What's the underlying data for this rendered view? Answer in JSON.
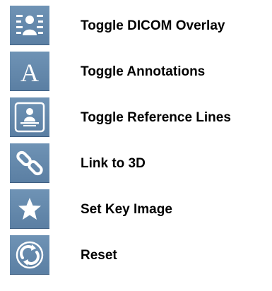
{
  "theme": {
    "button_bg": "#6283a8",
    "icon_color": "#ffffff",
    "text_color": "#000000"
  },
  "tools": [
    {
      "icon": "dicom-overlay-icon",
      "label": "Toggle DICOM Overlay"
    },
    {
      "icon": "annotations-icon",
      "label": "Toggle Annotations"
    },
    {
      "icon": "reference-lines-icon",
      "label": "Toggle Reference Lines"
    },
    {
      "icon": "link-icon",
      "label": "Link to 3D"
    },
    {
      "icon": "star-icon",
      "label": "Set Key Image"
    },
    {
      "icon": "reset-icon",
      "label": "Reset"
    }
  ]
}
